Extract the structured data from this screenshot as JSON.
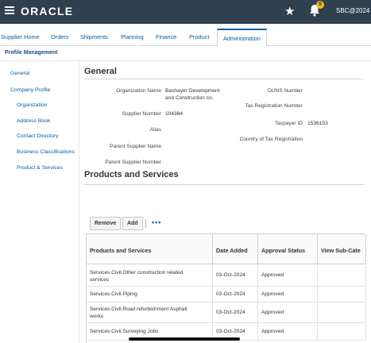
{
  "header": {
    "logo": "ORACLE",
    "notification_count": "9",
    "user": "SBC@2024"
  },
  "tabs": [
    "Supplier Home",
    "Orders",
    "Shipments",
    "Planning",
    "Finance",
    "Product",
    "Administration"
  ],
  "page_title": "Profile Management",
  "sidebar": {
    "items": [
      "General",
      "Company Profile",
      "Organization",
      "Address Book",
      "Contact Directory",
      "Business Classifications",
      "Product & Services"
    ]
  },
  "general": {
    "heading": "General",
    "organization_name_label": "Organization Name",
    "organization_name_line1": "Bashayer Development",
    "organization_name_line2": "and Construction co.",
    "supplier_number_label": "Supplier Number",
    "supplier_number": "104384",
    "alias_label": "Alias",
    "parent_supplier_name_label": "Parent Supplier Name",
    "parent_supplier_number_label": "Parent Supplier Number",
    "duns_label": "DUNS Number",
    "tax_reg_label": "Tax Registration Number",
    "taxpayer_id_label": "Taxpayer ID",
    "taxpayer_id": "1536153",
    "country_tax_label": "Country of Tax Registration"
  },
  "products": {
    "heading": "Products and Services",
    "remove_label": "Remove",
    "add_label": "Add",
    "more_label": "•••",
    "columns": [
      "Products and Services",
      "Date Added",
      "Approval Status",
      "View Sub-Cate"
    ],
    "rows": [
      {
        "line1": "Services.Civil.Other construction related",
        "line2": "services",
        "date": "03-Oct-2024",
        "status": "Approved"
      },
      {
        "line1": "Services.Civil.Piping",
        "line2": "",
        "date": "03-Oct-2024",
        "status": "Approved"
      },
      {
        "line1": "Services.Civil.Road refurbishment Asphalt",
        "line2": "works",
        "date": "03-Oct-2024",
        "status": "Approved"
      },
      {
        "line1": "Services.Civil.Surveying Jobs",
        "line2": "",
        "date": "03-Oct-2024",
        "status": "Approved"
      }
    ]
  }
}
